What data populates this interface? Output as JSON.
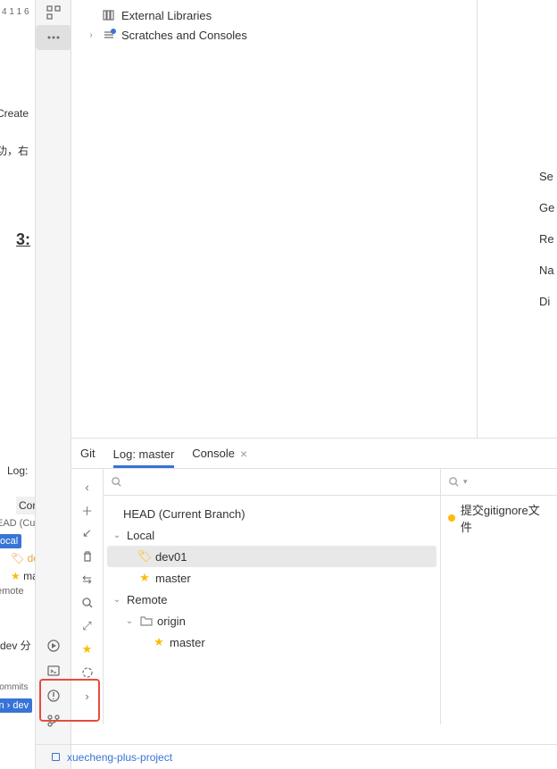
{
  "left_fragment": {
    "line_numbers": "4 1   1 6",
    "create_text": "Create",
    "cn_text1": "功，右",
    "bold_text": "3:",
    "log_text": "Log:",
    "con_text": "Con",
    "ead_text": "EAD (Cu",
    "ocal_badge": "ocal",
    "de_tag": "de",
    "ma_star": "ma",
    "emote_text": "emote",
    "dev_text": "dev 分",
    "commits_text": "Commits",
    "in_dev_badge": "in › dev"
  },
  "project_tree": {
    "external_libraries": "External Libraries",
    "scratches": "Scratches and Consoles"
  },
  "right_fragment": {
    "se": "Se",
    "ge": "Ge",
    "re": "Re",
    "na": "Na",
    "di": "Di"
  },
  "git_panel": {
    "tabs": {
      "git": "Git",
      "log": "Log: master",
      "console": "Console"
    },
    "branches": {
      "head": "HEAD (Current Branch)",
      "local": "Local",
      "dev01": "dev01",
      "master": "master",
      "remote": "Remote",
      "origin": "origin",
      "remote_master": "master"
    },
    "commit": {
      "message": "提交gitignore文件"
    }
  },
  "status_bar": {
    "project": "xuecheng-plus-project"
  }
}
